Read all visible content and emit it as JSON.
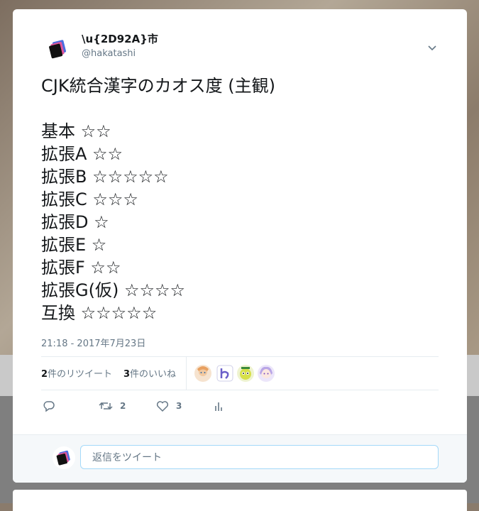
{
  "tweet": {
    "display_name": "\\u{2D92A}市",
    "screen_name": "@hakatashi",
    "text": "CJK統合漢字のカオス度 (主観)\n\n基本 ☆☆\n拡張A ☆☆\n拡張B ☆☆☆☆☆\n拡張C ☆☆☆\n拡張D ☆\n拡張E ☆\n拡張F ☆☆\n拡張G(仮) ☆☆☆☆\n互換 ☆☆☆☆☆",
    "timestamp": "21:18 - 2017年7月23日"
  },
  "stats": {
    "retweets_count": "2",
    "retweets_label": "件のリツイート",
    "likes_count": "3",
    "likes_label": "件のいいね"
  },
  "likers": [
    {
      "icon": "liker-avatar-1",
      "color": "#f2c9a0"
    },
    {
      "icon": "liker-avatar-2",
      "color": "#8a7fd0"
    },
    {
      "icon": "liker-avatar-3",
      "color": "#d7e04a"
    },
    {
      "icon": "liker-avatar-4",
      "color": "#b9a6e6"
    }
  ],
  "actions": {
    "reply_icon": "reply-icon",
    "retweet_icon": "retweet-icon",
    "retweet_count": "2",
    "like_icon": "heart-icon",
    "like_count": "3",
    "analytics_icon": "analytics-icon"
  },
  "reply": {
    "placeholder": "返信をツイート"
  },
  "colors": {
    "text": "#14171a",
    "secondary": "#657786",
    "border": "#e6ecf0",
    "input_border": "#a4d9f9"
  }
}
